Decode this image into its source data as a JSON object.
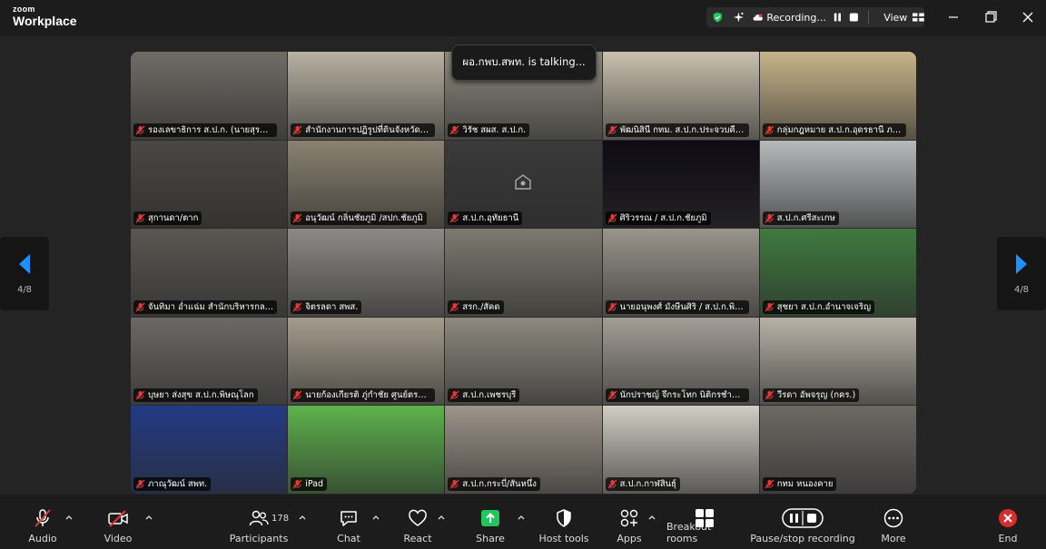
{
  "app": {
    "logo_top": "zoom",
    "logo_bottom": "Workplace"
  },
  "recording": {
    "label": "Recording...",
    "view_label": "View"
  },
  "talking_banner": "ผอ.กพบ.สพท. is talking...",
  "pager": {
    "left_label": "4/8",
    "right_label": "4/8"
  },
  "tiles": [
    {
      "name": "รองเลขาธิการ ส.ป.ก. (นายสุรชัย ยุทธ...",
      "bg": "#6f6c66"
    },
    {
      "name": "สำนักงานการปฏิรูปที่ดินจังหวัดแพร่",
      "bg": "#b9b2a2"
    },
    {
      "name": "วิรัช  สผส.  ส.ป.ก.",
      "bg": "#8f8a80"
    },
    {
      "name": "พัฒนิสินี กทม. ส.ป.ก.ประจวบคีรีขัน...",
      "bg": "#c9c0ae"
    },
    {
      "name": "กลุ่มกฎหมาย ส.ป.ก.อุดรธานี ภาค...",
      "bg": "#c8b48a"
    },
    {
      "name": "สุกานดา/ตาก",
      "bg": "#4a4844"
    },
    {
      "name": "อนุวัฒน์ กลิ่นชัยภูมิ /สปก.ชัยภูมิ",
      "bg": "#8a8170"
    },
    {
      "name": "ส.ป.ก.อุทัยธานี",
      "bg": "#3a3a3a"
    },
    {
      "name": "ศิริวรรณ / ส.ป.ก.ชัยภูมิ",
      "bg": "#0e0b14"
    },
    {
      "name": "ส.ป.ก.ศรีสะเกษ",
      "bg": "#b7b9bb"
    },
    {
      "name": "จันทิมา อ่ำแฉ่ม สำนักบริหารกลาง",
      "bg": "#5a5752"
    },
    {
      "name": "จิตรลดา สพส.",
      "bg": "#8c8a86"
    },
    {
      "name": "สรก./สัคด",
      "bg": "#7c7a70"
    },
    {
      "name": "นายอนุพงศ์ มังษีนศิริ / ส.ป.ก.พิษ...",
      "bg": "#9a958c"
    },
    {
      "name": "สุชยา ส.ป.ก.อำนาจเจริญ",
      "bg": "#3f7a3f"
    },
    {
      "name": "บุษยา ส่งสุข ส.ป.ก.พิษณุโลก",
      "bg": "#6b6965"
    },
    {
      "name": "นายก้องเกียรติ ภู่กำชัย ศูนย์ตรวจ...",
      "bg": "#a49c8c"
    },
    {
      "name": "ส.ป.ก.เพชรบุรี",
      "bg": "#8d8980"
    },
    {
      "name": "นักปราชญ์ จึกระโทก นิติกรชำนา...",
      "bg": "#a39d96"
    },
    {
      "name": "วีรดา อัพจรุญ (กคร.)",
      "bg": "#b8b1a6"
    },
    {
      "name": "ภาณุวัฒน์ สพท.",
      "bg": "#233a86"
    },
    {
      "name": "iPad",
      "bg": "#5db34c"
    },
    {
      "name": "ส.ป.ก.กระบี่/สันหนึ่ง",
      "bg": "#9d948a"
    },
    {
      "name": "ส.ป.ก.กาฬสินธุ์",
      "bg": "#d0cdc4"
    },
    {
      "name": "กทม หนองคาย",
      "bg": "#6d6a64"
    }
  ],
  "toolbar": {
    "audio": "Audio",
    "video": "Video",
    "participants": "Participants",
    "participants_count": "178",
    "chat": "Chat",
    "react": "React",
    "share": "Share",
    "host_tools": "Host tools",
    "apps": "Apps",
    "breakout_rooms": "Breakout rooms",
    "pause_stop_recording": "Pause/stop recording",
    "more": "More",
    "end": "End"
  },
  "colors": {
    "share_green": "#22c55e",
    "end_red": "#d32f2f",
    "muted_red": "#e53935",
    "shield_green": "#22c55e"
  }
}
